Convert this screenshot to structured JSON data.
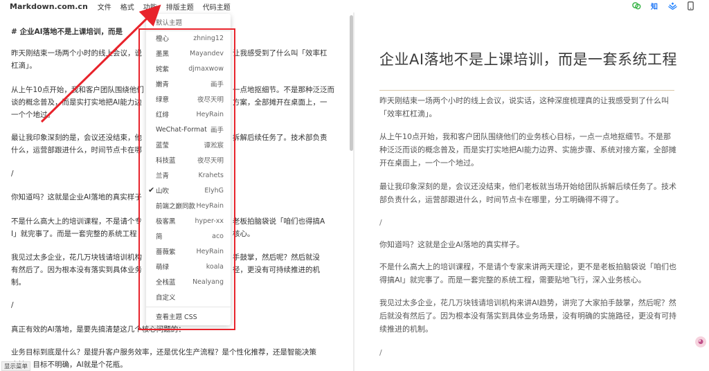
{
  "app": {
    "brand": "Markdown.com.cn",
    "menu": [
      "文件",
      "格式",
      "功能",
      "排版主题",
      "代码主题"
    ],
    "icons": {
      "wechat": "wechat-icon",
      "zhihu": "知",
      "juejin": "juejin-icon",
      "phone": "phone-icon"
    },
    "bottom_button": "显示菜单",
    "float_button": "icon"
  },
  "editor": {
    "lines": [
      "#  企业AI落地不是上课培训，而是",
      "昨天刚结束一场两个小时的线上会议，说",
      "杠滴」。",
      "从上午10点开始，我和客户团队围绕他们",
      "谈的概念普及，而是实打实地把AI能力边",
      "一个个地过。",
      "最让我印象深刻的是，会议还没结束，他",
      "什么，运营部跟进什么，时间节点卡在哪",
      "/",
      "你知道吗？这就是企业AI落地的真实样子",
      "不是什么高大上的培训课程，不是请个专",
      "I」就完事了。而是一套完整的系统工程",
      "我见过太多企业，花几万块钱请培训机构",
      "有然后了。因为根本没有落实到具体业务",
      "制。",
      "/",
      "真正有效的AI落地，是要先搞清楚这几个核心问题的：",
      "业务目标到底是什么？是提升客户服务效率，还是优化生产流程？是个性化推荐，还是智能决策",
      "支持？目标不明确，AI就是个花瓶。"
    ],
    "tails": [
      "",
      "让我感受到了什么叫「效率杠",
      "",
      "一点地抠细节。不是那种泛泛而",
      "方案，全部摊开在桌面上，一",
      "",
      "拆解后续任务了。技术部负责",
      "",
      "",
      "",
      "老板拍脑袋说「咱们也得搞A",
      "核心。",
      "手鼓掌，然后呢？然后就没",
      "径，更没有可持续推进的机",
      "",
      "",
      "",
      "",
      ""
    ]
  },
  "theme_menu": {
    "header": "默认主题",
    "items": [
      {
        "name": "橙心",
        "author": "zhning12"
      },
      {
        "name": "墨黑",
        "author": "Mayandev"
      },
      {
        "name": "姹紫",
        "author": "djmaxwow"
      },
      {
        "name": "嫩青",
        "author": "画手"
      },
      {
        "name": "绿意",
        "author": "夜尽天明"
      },
      {
        "name": "红绯",
        "author": "HeyRain"
      },
      {
        "name": "WeChat-Format",
        "author": "画手"
      },
      {
        "name": "蓝莹",
        "author": "谭淞宸"
      },
      {
        "name": "科技蓝",
        "author": "夜尽天明"
      },
      {
        "name": "兰青",
        "author": "Krahets"
      },
      {
        "name": "山吹",
        "author": "ElyhG",
        "selected": true
      },
      {
        "name": "前端之巅同款",
        "author": "HeyRain"
      },
      {
        "name": "极客黑",
        "author": "hyper-xx"
      },
      {
        "name": "简",
        "author": "aco"
      },
      {
        "name": "蔷薇紫",
        "author": "HeyRain"
      },
      {
        "name": "萌绿",
        "author": "koala"
      },
      {
        "name": "全栈蓝",
        "author": "Nealyang"
      },
      {
        "name": "自定义",
        "author": ""
      }
    ],
    "footer": "查看主题 CSS",
    "check_glyph": "✔"
  },
  "preview": {
    "title": "企业AI落地不是上课培训，而是一套系统工程",
    "paragraphs": [
      "昨天刚结束一场两个小时的线上会议，说实话，这种深度梳理真的让我感受到了什么叫「效率杠杠滴」。",
      "从上午10点开始，我和客户团队围绕他们的业务核心目标，一点一点地抠细节。不是那种泛泛而谈的概念普及，而是实打实地把AI能力边界、实施步骤、系统对接方案，全部摊开在桌面上，一个一个地过。",
      "最让我印象深刻的是，会议还没结束，他们老板就当场开始给团队拆解后续任务了。技术部负责什么，运营部跟进什么，时间节点卡在哪里，分工明确得不得了。",
      "/",
      "你知道吗？这就是企业AI落地的真实样子。",
      "不是什么高大上的培训课程，不是请个专家来讲两天理论，更不是老板拍脑袋说「咱们也得搞AI」就完事了。而是一套完整的系统工程，需要贴地飞行，深入业务核心。",
      "我见过太多企业，花几万块钱请培训机构来讲AI趋势，讲完了大家拍手鼓掌，然后呢？然后就没有然后了。因为根本没有落实到具体业务场景，没有明确的实施路径，更没有可持续推进的机制。",
      "/"
    ]
  },
  "colors": {
    "highlight": "#e8232b",
    "accent": "#d8c6a6"
  }
}
